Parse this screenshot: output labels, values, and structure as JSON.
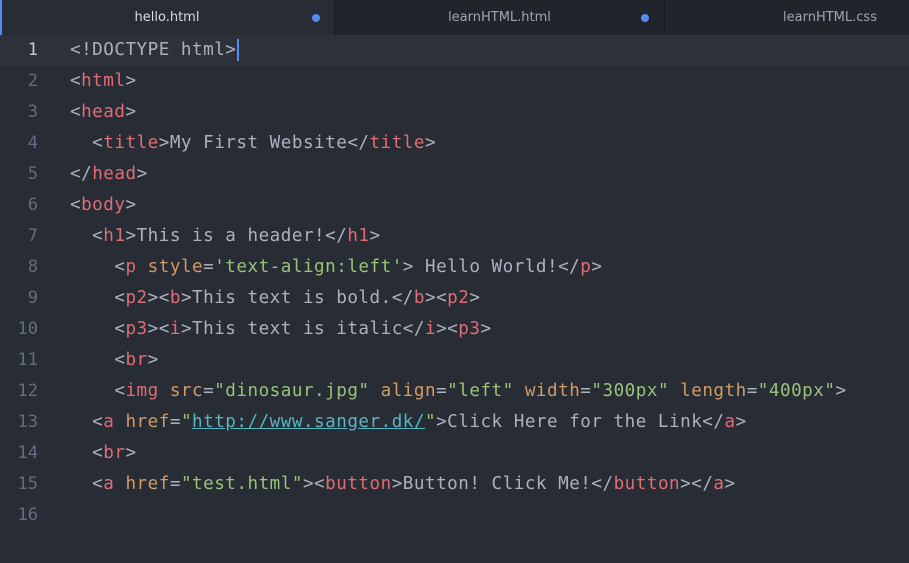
{
  "tabs": [
    {
      "label": "hello.html",
      "active": true,
      "modified": true
    },
    {
      "label": "learnHTML.html",
      "active": false,
      "modified": true
    },
    {
      "label": "learnHTML.css",
      "active": false,
      "modified": false
    }
  ],
  "current_line": 1,
  "lines": [
    {
      "num": "1",
      "tokens": [
        [
          "p",
          "<!DOCTYPE html>"
        ]
      ]
    },
    {
      "num": "2",
      "tokens": [
        [
          "p",
          "<"
        ],
        [
          "t",
          "html"
        ],
        [
          "p",
          ">"
        ]
      ]
    },
    {
      "num": "3",
      "tokens": [
        [
          "p",
          "<"
        ],
        [
          "t",
          "head"
        ],
        [
          "p",
          ">"
        ]
      ]
    },
    {
      "num": "4",
      "tokens": [
        [
          "p",
          "  <"
        ],
        [
          "t",
          "title"
        ],
        [
          "p",
          ">My First Website</"
        ],
        [
          "t",
          "title"
        ],
        [
          "p",
          ">"
        ]
      ]
    },
    {
      "num": "5",
      "tokens": [
        [
          "p",
          "</"
        ],
        [
          "t",
          "head"
        ],
        [
          "p",
          ">"
        ]
      ]
    },
    {
      "num": "6",
      "tokens": [
        [
          "p",
          "<"
        ],
        [
          "t",
          "body"
        ],
        [
          "p",
          ">"
        ]
      ]
    },
    {
      "num": "7",
      "tokens": [
        [
          "p",
          "  <"
        ],
        [
          "t",
          "h1"
        ],
        [
          "p",
          ">This is a header!</"
        ],
        [
          "t",
          "h1"
        ],
        [
          "p",
          ">"
        ]
      ]
    },
    {
      "num": "8",
      "tokens": [
        [
          "p",
          "    <"
        ],
        [
          "t",
          "p"
        ],
        [
          "p",
          " "
        ],
        [
          "a",
          "style"
        ],
        [
          "p",
          "="
        ],
        [
          "s",
          "'text-align:left'"
        ],
        [
          "p",
          "> Hello World!</"
        ],
        [
          "t",
          "p"
        ],
        [
          "p",
          ">"
        ]
      ]
    },
    {
      "num": "9",
      "tokens": [
        [
          "p",
          "    <"
        ],
        [
          "t",
          "p2"
        ],
        [
          "p",
          "><"
        ],
        [
          "t",
          "b"
        ],
        [
          "p",
          ">This text is bold.</"
        ],
        [
          "t",
          "b"
        ],
        [
          "p",
          "><"
        ],
        [
          "t",
          "p2"
        ],
        [
          "p",
          ">"
        ]
      ]
    },
    {
      "num": "10",
      "tokens": [
        [
          "p",
          "    <"
        ],
        [
          "t",
          "p3"
        ],
        [
          "p",
          "><"
        ],
        [
          "t",
          "i"
        ],
        [
          "p",
          ">This text is italic</"
        ],
        [
          "t",
          "i"
        ],
        [
          "p",
          "><"
        ],
        [
          "t",
          "p3"
        ],
        [
          "p",
          ">"
        ]
      ]
    },
    {
      "num": "11",
      "tokens": [
        [
          "p",
          "    <"
        ],
        [
          "t",
          "br"
        ],
        [
          "p",
          ">"
        ]
      ]
    },
    {
      "num": "12",
      "tokens": [
        [
          "p",
          "    <"
        ],
        [
          "t",
          "img"
        ],
        [
          "p",
          " "
        ],
        [
          "a",
          "src"
        ],
        [
          "p",
          "="
        ],
        [
          "s",
          "\"dinosaur.jpg\""
        ],
        [
          "p",
          " "
        ],
        [
          "a",
          "align"
        ],
        [
          "p",
          "="
        ],
        [
          "s",
          "\"left\""
        ],
        [
          "p",
          " "
        ],
        [
          "a",
          "width"
        ],
        [
          "p",
          "="
        ],
        [
          "s",
          "\"300px\""
        ],
        [
          "p",
          " "
        ],
        [
          "a",
          "length"
        ],
        [
          "p",
          "="
        ],
        [
          "s",
          "\"400px\""
        ],
        [
          "p",
          ">"
        ]
      ]
    },
    {
      "num": "13",
      "tokens": [
        [
          "p",
          "  <"
        ],
        [
          "t",
          "a"
        ],
        [
          "p",
          " "
        ],
        [
          "a",
          "href"
        ],
        [
          "p",
          "="
        ],
        [
          "s",
          "\""
        ],
        [
          "u",
          "http://www.sanger.dk/"
        ],
        [
          "s",
          "\""
        ],
        [
          "p",
          ">Click Here for the Link</"
        ],
        [
          "t",
          "a"
        ],
        [
          "p",
          ">"
        ]
      ]
    },
    {
      "num": "14",
      "tokens": [
        [
          "p",
          "  <"
        ],
        [
          "t",
          "br"
        ],
        [
          "p",
          ">"
        ]
      ]
    },
    {
      "num": "15",
      "tokens": [
        [
          "p",
          "  <"
        ],
        [
          "t",
          "a"
        ],
        [
          "p",
          " "
        ],
        [
          "a",
          "href"
        ],
        [
          "p",
          "="
        ],
        [
          "s",
          "\"test.html\""
        ],
        [
          "p",
          "><"
        ],
        [
          "t",
          "button"
        ],
        [
          "p",
          ">Button! Click Me!</"
        ],
        [
          "t",
          "button"
        ],
        [
          "p",
          "></"
        ],
        [
          "t",
          "a"
        ],
        [
          "p",
          ">"
        ]
      ]
    },
    {
      "num": "16",
      "tokens": []
    }
  ],
  "colors": {
    "background": "#282c34",
    "tag": "#e06c75",
    "attribute": "#d19a66",
    "string": "#98c379",
    "url": "#56b6c2",
    "plain": "#abb2bf",
    "accent": "#568af2"
  }
}
